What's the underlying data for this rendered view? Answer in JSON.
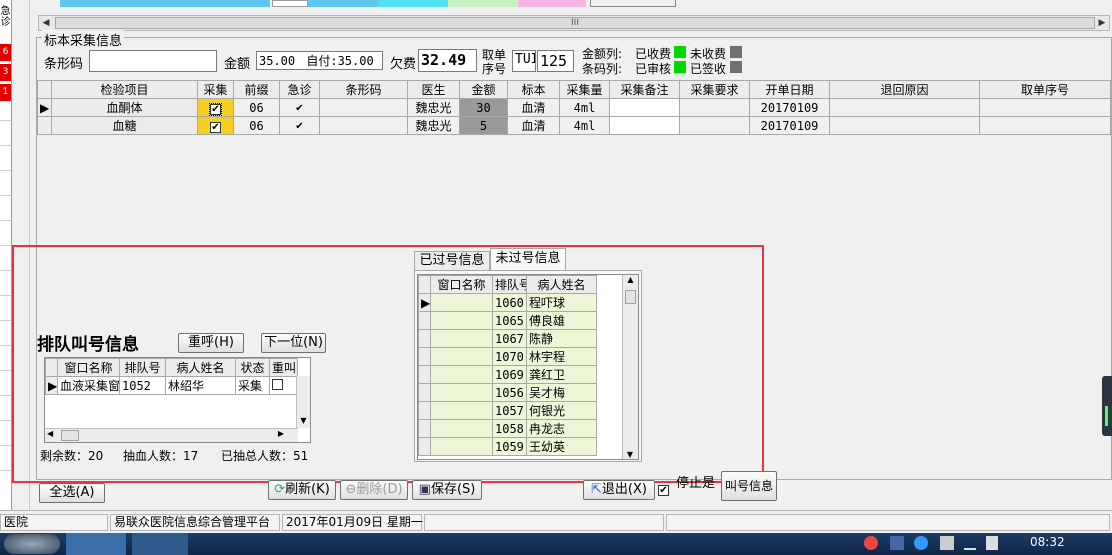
{
  "left_strip": {
    "label_top": "急诊",
    "red_items": [
      "6",
      "3",
      "1"
    ]
  },
  "top_scroll_thumb": "III",
  "specimen": {
    "group_title": "标本采集信息",
    "barcode_label": "条形码",
    "barcode_value": "",
    "amount_label": "金额",
    "amount_value": "35.00",
    "self_pay_value": "自付:35.00",
    "owed_label": "欠费",
    "owed_value": "32.49",
    "take_no_label_1": "取单",
    "take_no_label_2": "序号",
    "take_no_prefix": "TUI",
    "take_no_value": "125",
    "amount_col_label": "金额列:",
    "barcode_col_label": "条码列:",
    "paid_label": "已收费",
    "unpaid_label": "未收费",
    "reviewed_label": "已审核",
    "signed_label": "已签收",
    "colors": {
      "paid": "#00d800",
      "unpaid": "#707070",
      "reviewed": "#00d800",
      "signed": "#707070"
    }
  },
  "items_table": {
    "headers": [
      "检验项目",
      "采集",
      "前缀",
      "急诊",
      "条形码",
      "医生",
      "金额",
      "标本",
      "采集量",
      "采集备注",
      "采集要求",
      "开单日期",
      "退回原因",
      "取单序号"
    ],
    "rows": [
      {
        "item": "血酮体",
        "prefix": "06",
        "doctor": "魏忠光",
        "amount": "30",
        "specimen": "血清",
        "volume": "4ml",
        "date": "20170109"
      },
      {
        "item": "血糖",
        "prefix": "06",
        "doctor": "魏忠光",
        "amount": "5",
        "specimen": "血清",
        "volume": "4ml",
        "date": "20170109"
      }
    ]
  },
  "queue": {
    "title": "排队叫号信息",
    "recall_button": "重呼(H)",
    "next_button": "下一位(N)",
    "headers": [
      "窗口名称",
      "排队号",
      "病人姓名",
      "状态",
      "重叫"
    ],
    "rows": [
      {
        "window": "血液采集窗",
        "number": "1052",
        "name": "林绍华",
        "status": "采集"
      }
    ],
    "summary_remaining": "剩余数：20",
    "summary_drawn": "抽血人数：17",
    "summary_total": "已抽总人数：51"
  },
  "called": {
    "tab_passed": "已过号信息",
    "tab_pending": "未过号信息",
    "headers": [
      "窗口名称",
      "排队号",
      "病人姓名"
    ],
    "rows": [
      {
        "number": "1060",
        "name": "程吓球"
      },
      {
        "number": "1065",
        "name": "傅良雄"
      },
      {
        "number": "1067",
        "name": "陈静"
      },
      {
        "number": "1070",
        "name": "林宇程"
      },
      {
        "number": "1069",
        "name": "龚红卫"
      },
      {
        "number": "1056",
        "name": "吴才梅"
      },
      {
        "number": "1057",
        "name": "何银光"
      },
      {
        "number": "1058",
        "name": "冉龙志"
      },
      {
        "number": "1059",
        "name": "王幼英"
      }
    ]
  },
  "bottom_buttons": {
    "select_all": "全选(A)",
    "refresh": "刷新(K)",
    "delete": "删除(D)",
    "save": "保存(S)",
    "exit": "退出(X)",
    "stop_label": "停止是",
    "call_info": "叫号信息"
  },
  "status_bar": {
    "hospital": "医院",
    "system": "易联众医院信息综合管理平台",
    "date": "2017年01月09日 星期一"
  },
  "taskbar": {
    "clock": "08:32"
  }
}
